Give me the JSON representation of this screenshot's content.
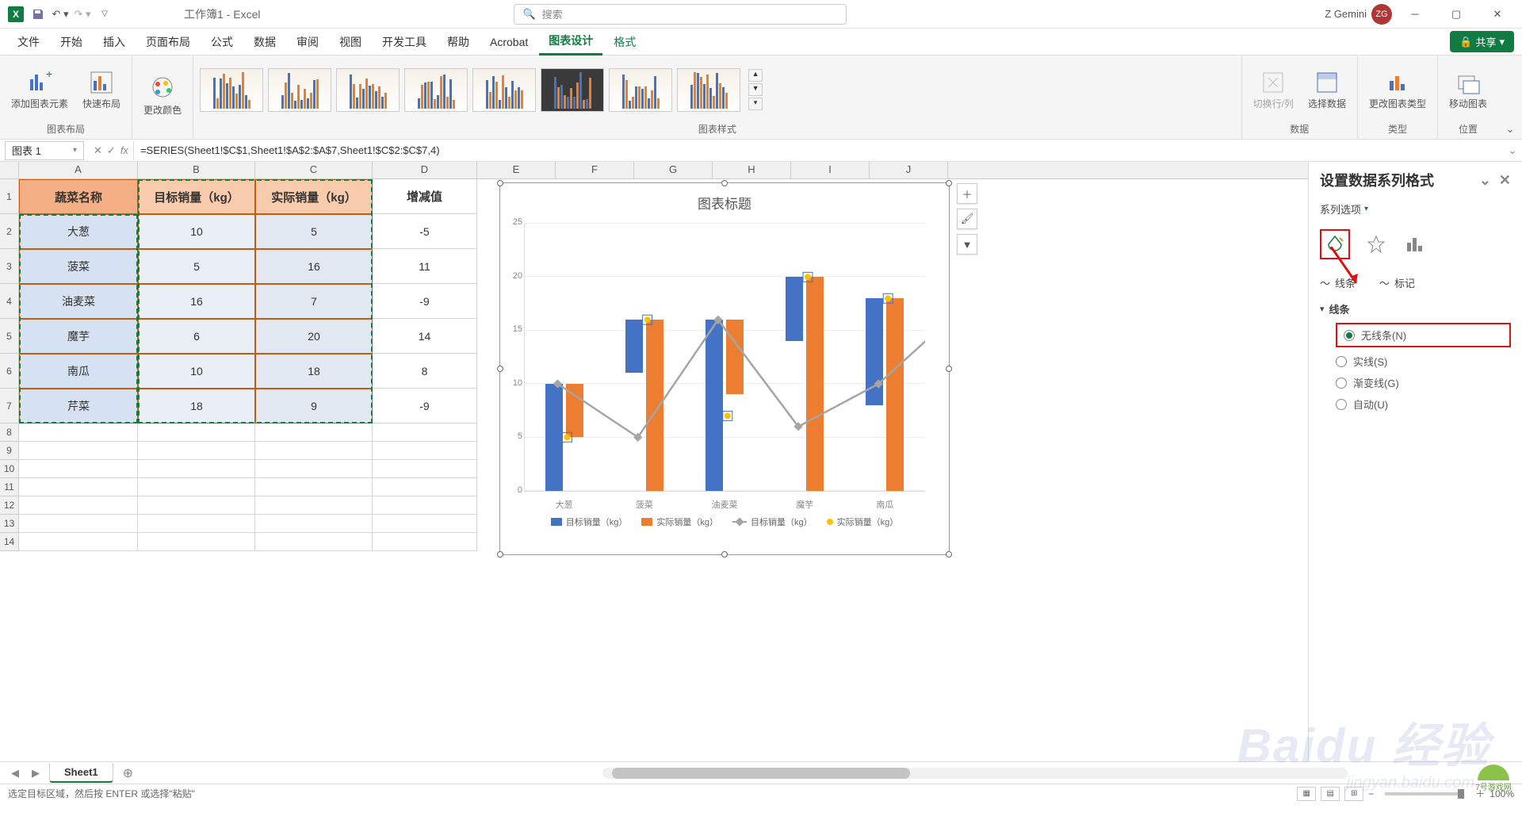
{
  "app": {
    "title": "工作簿1 - Excel",
    "user_name": "Z Gemini",
    "user_initials": "ZG",
    "search_placeholder": "搜索",
    "share_label": "共享"
  },
  "tabs": {
    "file": "文件",
    "home": "开始",
    "insert": "插入",
    "page_layout": "页面布局",
    "formulas": "公式",
    "data": "数据",
    "review": "审阅",
    "view": "视图",
    "dev": "开发工具",
    "help": "帮助",
    "acrobat": "Acrobat",
    "chart_design": "图表设计",
    "format": "格式"
  },
  "ribbon": {
    "group_layout": "图表布局",
    "add_element": "添加图表元素",
    "quick_layout": "快速布局",
    "change_colors": "更改颜色",
    "group_styles": "图表样式",
    "switch_rowcol": "切换行/列",
    "select_data": "选择数据",
    "group_data": "数据",
    "change_type": "更改图表类型",
    "group_type": "类型",
    "move_chart": "移动图表",
    "group_location": "位置"
  },
  "formula_bar": {
    "name_box": "图表 1",
    "formula": "=SERIES(Sheet1!$C$1,Sheet1!$A$2:$A$7,Sheet1!$C$2:$C$7,4)"
  },
  "columns": [
    "A",
    "B",
    "C",
    "D",
    "E",
    "F",
    "G",
    "H",
    "I",
    "J"
  ],
  "table": {
    "headers": {
      "a": "蔬菜名称",
      "b": "目标销量（kg）",
      "c": "实际销量（kg）",
      "d": "增减值"
    },
    "rows": [
      {
        "a": "大葱",
        "b": "10",
        "c": "5",
        "d": "-5"
      },
      {
        "a": "菠菜",
        "b": "5",
        "c": "16",
        "d": "11"
      },
      {
        "a": "油麦菜",
        "b": "16",
        "c": "7",
        "d": "-9"
      },
      {
        "a": "魔芋",
        "b": "6",
        "c": "20",
        "d": "14"
      },
      {
        "a": "南瓜",
        "b": "10",
        "c": "18",
        "d": "8"
      },
      {
        "a": "芹菜",
        "b": "18",
        "c": "9",
        "d": "-9"
      }
    ]
  },
  "chart_data": {
    "type": "bar",
    "title": "图表标题",
    "categories": [
      "大葱",
      "菠菜",
      "油麦菜",
      "魔芋",
      "南瓜"
    ],
    "series": [
      {
        "name": "目标销量（kg）",
        "type": "bar",
        "color": "#4472c4",
        "values": [
          10,
          5,
          16,
          6,
          10
        ]
      },
      {
        "name": "实际销量（kg）",
        "type": "bar",
        "color": "#ed7d31",
        "values": [
          5,
          16,
          7,
          20,
          18
        ]
      },
      {
        "name": "目标销量（kg）",
        "type": "line",
        "color": "#a5a5a5",
        "values": [
          10,
          5,
          16,
          6,
          10
        ]
      },
      {
        "name": "实际销量（kg）",
        "type": "scatter",
        "color": "#ffc000",
        "values": [
          5,
          16,
          7,
          20,
          18
        ]
      }
    ],
    "ylim": [
      0,
      25
    ],
    "yticks": [
      0,
      5,
      10,
      15,
      20,
      25
    ],
    "xlabel": "",
    "ylabel": ""
  },
  "format_pane": {
    "title": "设置数据系列格式",
    "series_options": "系列选项",
    "tab_line": "线条",
    "tab_marker": "标记",
    "section_line": "线条",
    "options": {
      "no_line": "无线条(N)",
      "solid": "实线(S)",
      "gradient": "渐变线(G)",
      "auto": "自动(U)"
    },
    "selected": "no_line"
  },
  "sheet": {
    "name": "Sheet1"
  },
  "statusbar": {
    "message": "选定目标区域，然后按 ENTER 或选择\"粘贴\"",
    "zoom": "100%"
  },
  "watermark": {
    "main": "Baidu 经验",
    "sub": "jingyan.baidu.com",
    "corner": "7号游戏网"
  }
}
